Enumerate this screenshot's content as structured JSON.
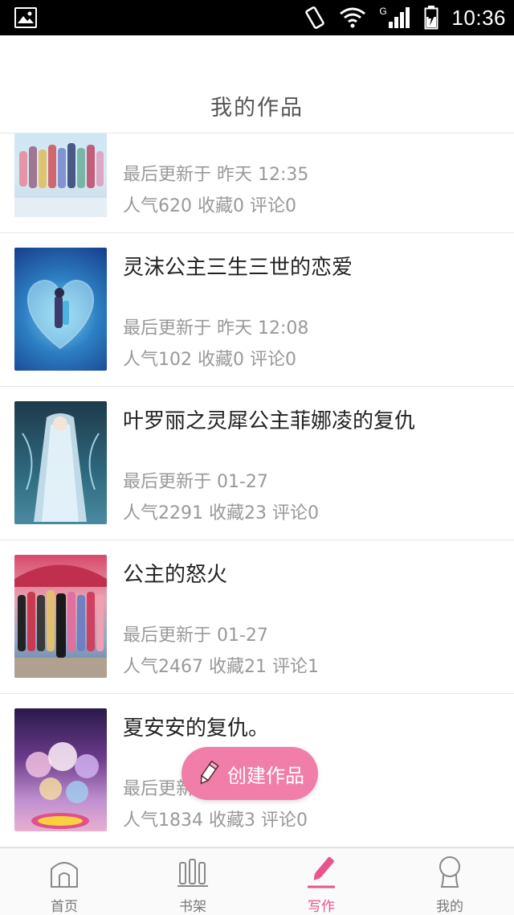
{
  "status_bar": {
    "time": "10:36",
    "network": "G"
  },
  "header": {
    "title": "我的作品"
  },
  "works": [
    {
      "title": "",
      "updated": "最后更新于 昨天 12:35",
      "stats": "人气620 收藏0 评论0"
    },
    {
      "title": "灵沫公主三生三世的恋爱",
      "updated": "最后更新于 昨天 12:08",
      "stats": "人气102 收藏0 评论0"
    },
    {
      "title": "叶罗丽之灵犀公主菲娜凌的复仇",
      "updated": "最后更新于 01-27",
      "stats": "人气2291 收藏23 评论0"
    },
    {
      "title": "公主的怒火",
      "updated": "最后更新于 01-27",
      "stats": "人气2467 收藏21 评论1"
    },
    {
      "title": "夏安安的复仇。",
      "updated": "最后更新于 01-27",
      "stats": "人气1834 收藏3 评论0"
    }
  ],
  "fab": {
    "label": "创建作品",
    "icon": "pencil-icon"
  },
  "tabs": [
    {
      "label": "首页",
      "icon": "home-icon"
    },
    {
      "label": "书架",
      "icon": "bookshelf-icon"
    },
    {
      "label": "写作",
      "icon": "pencil-icon"
    },
    {
      "label": "我的",
      "icon": "user-icon"
    }
  ],
  "colors": {
    "accent": "#e8548c",
    "fab": "#f07ea8",
    "muted_text": "#999999",
    "divider": "#e6e6e6"
  }
}
